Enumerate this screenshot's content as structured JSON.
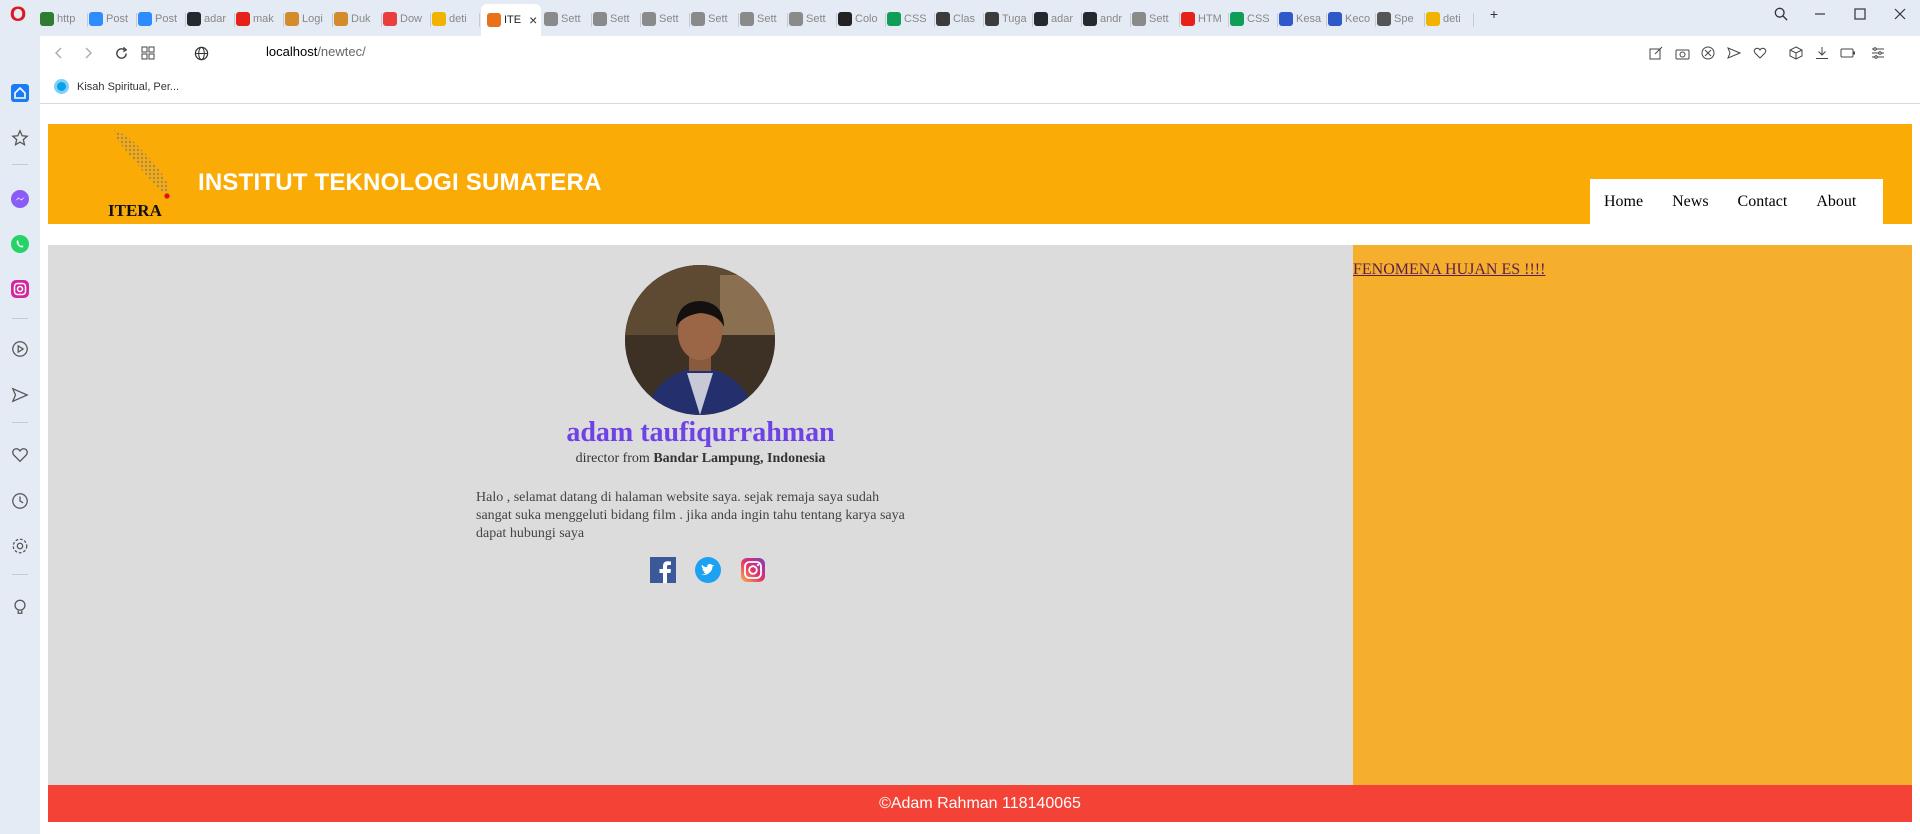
{
  "browser": {
    "tabs": [
      "http",
      "Post",
      "Post",
      "adar",
      "mak",
      "Logi",
      "Duk",
      "Dow",
      "deti",
      "ITE",
      "Sett",
      "Sett",
      "Sett",
      "Sett",
      "Sett",
      "Sett",
      "Colo",
      "CSS",
      "Clas",
      "Tuga",
      "adar",
      "andr",
      "Sett",
      "HTM",
      "CSS",
      "Kesa",
      "Keco",
      "Spe",
      "deti"
    ],
    "active_tab": "ITE",
    "url_host": "localhost",
    "url_path": "/newtec/",
    "bookmark": "Kisah Spiritual, Per..."
  },
  "site": {
    "logo_text": "ITERA",
    "title": "INSTITUT TEKNOLOGI SUMATERA",
    "nav": [
      "Home",
      "News",
      "Contact",
      "About"
    ]
  },
  "profile": {
    "name": "adam taufiqurrahman",
    "role_prefix": "director from",
    "role_location": "Bandar Lampung, Indonesia",
    "bio": "Halo , selamat datang di halaman website saya. sejak remaja saya sudah sangat suka menggeluti bidang film . jika anda ingin tahu tentang karya saya dapat hubungi saya",
    "social": [
      "facebook-icon",
      "twitter-icon",
      "instagram-icon"
    ]
  },
  "aside": {
    "link": "FENOMENA HUJAN ES !!!!"
  },
  "footer": {
    "text": "©Adam Rahman 118140065"
  },
  "colors": {
    "header": "#fbab05",
    "aside": "#f6ae2d",
    "main": "#dcdcdc",
    "footer": "#f44336",
    "name": "#6e42e5"
  }
}
